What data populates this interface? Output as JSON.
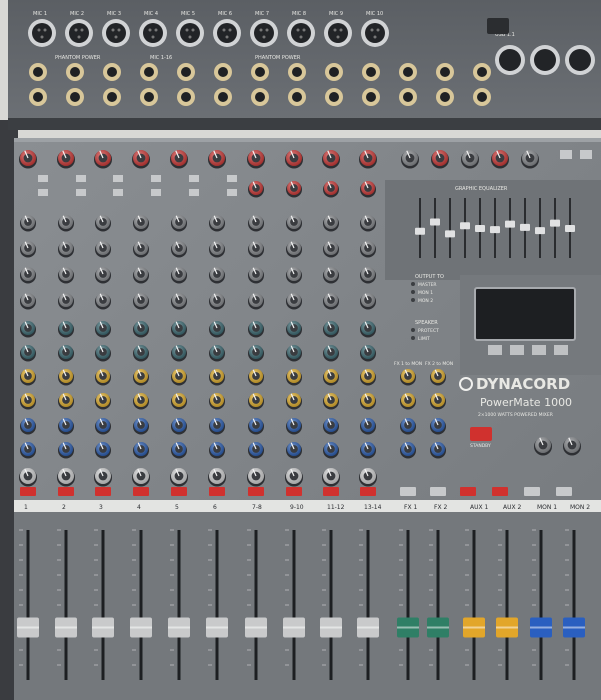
{
  "brand": {
    "name": "DYNACORD",
    "model": "PowerMate 1000",
    "subtitle": "2×1000 WATTS POWERED MIXER",
    "standby": "STANDBY"
  },
  "colors": {
    "panel": "#7f8387",
    "panel_dark": "#3f4246",
    "knob_red": "#d43c3a",
    "knob_gray": "#8c8f93",
    "knob_teal": "#3f6f78",
    "knob_yellow": "#e8b530",
    "knob_blue": "#2e62b8",
    "mute_red": "#d0312e",
    "fader_gray": "#c9cacb",
    "fader_green": "#2f7f66",
    "fader_yellow": "#e2a62a",
    "fader_blue": "#2a5fc0"
  },
  "top_panel": {
    "mic_labels": [
      "MIC 1",
      "MIC 2",
      "MIC 3",
      "MIC 4",
      "MIC 5",
      "MIC 6",
      "MIC 7",
      "MIC 8",
      "MIC 9",
      "MIC 10"
    ],
    "mic_mid_label": "MIC 1-16",
    "phantom_label_1": "PHANTOM POWER",
    "phantom_label_2": "PHANTOM POWER",
    "usb_label": "USB 1.1"
  },
  "channel_strips": {
    "bottom_labels": [
      "1",
      "2",
      "3",
      "4",
      "5",
      "6",
      "7-8",
      "9-10",
      "11-12",
      "13-14",
      "FX 1",
      "FX 2",
      "AUX 1",
      "AUX 2",
      "MON 1",
      "MON 2"
    ],
    "section_labels": [
      "FX 1 to MON",
      "FX 2 to MON"
    ],
    "mute_label": "MUTE"
  },
  "graphic_eq": {
    "title": "GRAPHIC EQUALIZER",
    "positions": [
      0.45,
      0.62,
      0.4,
      0.55,
      0.5,
      0.48,
      0.58,
      0.52,
      0.46,
      0.6,
      0.5
    ]
  },
  "output_source": {
    "title": "OUTPUT TO",
    "options": [
      "MASTER",
      "MON 1",
      "MON 2"
    ]
  },
  "limiter": {
    "title": "SPEAKER",
    "options": [
      "PROTECT",
      "LIMIT"
    ]
  },
  "fader_levels": [
    0.35,
    0.35,
    0.35,
    0.35,
    0.35,
    0.35,
    0.35,
    0.35,
    0.35,
    0.35,
    0.35,
    0.35,
    0.35,
    0.35,
    0.35,
    0.35
  ]
}
